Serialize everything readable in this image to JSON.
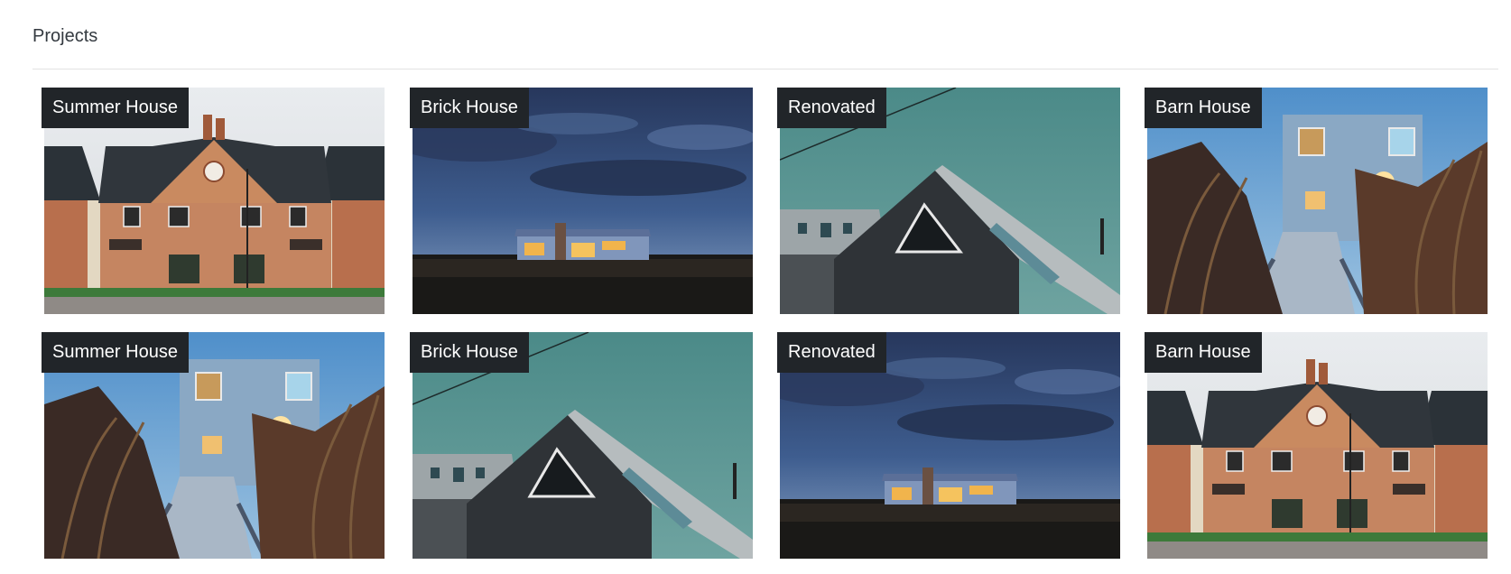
{
  "page": {
    "heading": "Projects"
  },
  "projects": [
    {
      "title": "Summer House",
      "scene": "brick"
    },
    {
      "title": "Brick House",
      "scene": "night"
    },
    {
      "title": "Renovated",
      "scene": "barn"
    },
    {
      "title": "Barn House",
      "scene": "boardwalk"
    },
    {
      "title": "Summer House",
      "scene": "boardwalk"
    },
    {
      "title": "Brick House",
      "scene": "barn"
    },
    {
      "title": "Renovated",
      "scene": "night"
    },
    {
      "title": "Barn House",
      "scene": "brick"
    }
  ],
  "colors": {
    "tag_background": "#212529",
    "tag_text": "#ffffff",
    "divider": "#e2e2e2"
  }
}
